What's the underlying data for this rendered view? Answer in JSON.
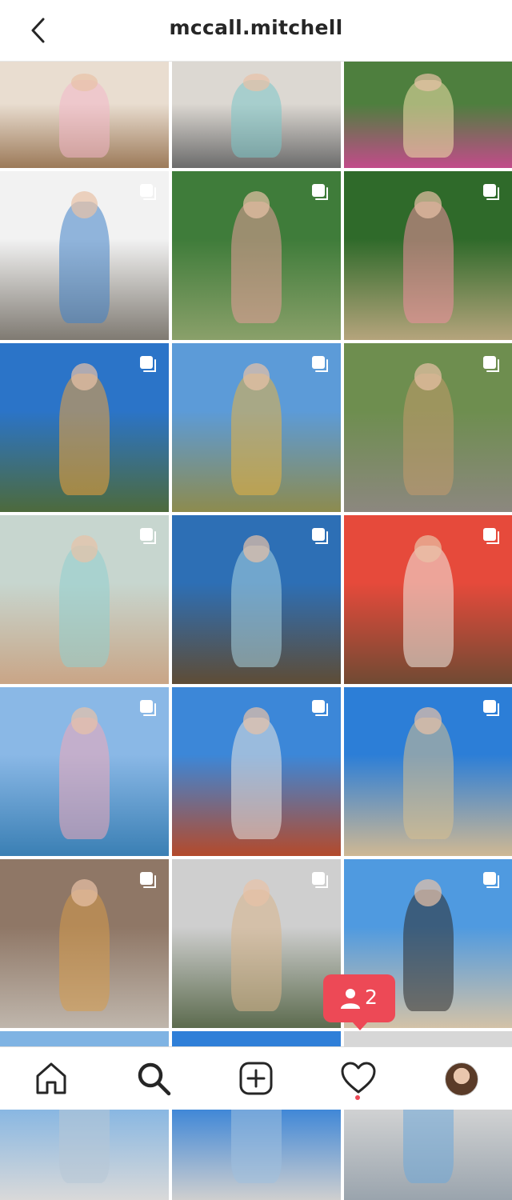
{
  "header": {
    "username": "mccall.mitchell",
    "back_icon": "chevron-left-icon"
  },
  "grid": {
    "posts": [
      {
        "multi": false,
        "top": "#e9ddd0",
        "bottom": "#9c7a59",
        "accent": "#f3b6c9"
      },
      {
        "multi": false,
        "top": "#dcd8d2",
        "bottom": "#6b6b6b",
        "accent": "#7cc7c9"
      },
      {
        "multi": false,
        "top": "#4e7f3e",
        "bottom": "#c24b8a",
        "accent": "#f2e2a9"
      },
      {
        "multi": true,
        "top": "#f2f2f2",
        "bottom": "#7f7a72",
        "accent": "#3f82c9"
      },
      {
        "multi": true,
        "top": "#3f7c3a",
        "bottom": "#8aa06a",
        "accent": "#e79c9a"
      },
      {
        "multi": true,
        "top": "#2f6a2a",
        "bottom": "#b5a47c",
        "accent": "#f08ea0"
      },
      {
        "multi": true,
        "top": "#2b74c8",
        "bottom": "#4d6a3c",
        "accent": "#f0a33a"
      },
      {
        "multi": true,
        "top": "#5c9bd8",
        "bottom": "#8d8b4e",
        "accent": "#e7b243"
      },
      {
        "multi": true,
        "top": "#6e8e4f",
        "bottom": "#8c877f",
        "accent": "#c59a6c"
      },
      {
        "multi": true,
        "top": "#c7d6cf",
        "bottom": "#c9a586",
        "accent": "#8fcfd0"
      },
      {
        "multi": true,
        "top": "#2d6fb5",
        "bottom": "#5e4c36",
        "accent": "#a9d4e0"
      },
      {
        "multi": true,
        "top": "#e64a3b",
        "bottom": "#704a33",
        "accent": "#f2efe7"
      },
      {
        "multi": true,
        "top": "#8ab8e6",
        "bottom": "#3a7fb4",
        "accent": "#f3a7b6"
      },
      {
        "multi": true,
        "top": "#3c87d8",
        "bottom": "#b44a2b",
        "accent": "#e8e6e2"
      },
      {
        "multi": true,
        "top": "#2c7ed7",
        "bottom": "#cfb893",
        "accent": "#d7c08f"
      },
      {
        "multi": true,
        "top": "#8f7766",
        "bottom": "#bfb6ac",
        "accent": "#d59a4a"
      },
      {
        "multi": true,
        "top": "#cfcfcf",
        "bottom": "#5c6b4e",
        "accent": "#d9b48a"
      },
      {
        "multi": true,
        "top": "#4f9ae0",
        "bottom": "#d3c2a7",
        "accent": "#2b2b2b"
      },
      {
        "multi": false,
        "top": "#7fb3e3",
        "bottom": "#d9d9d9",
        "accent": "#b6c7d6"
      },
      {
        "multi": false,
        "top": "#2f7fd8",
        "bottom": "#cfcfcf",
        "accent": "#9fc0df"
      },
      {
        "multi": false,
        "top": "#d7d7d7",
        "bottom": "#9aa4ad",
        "accent": "#6ea8d8"
      }
    ]
  },
  "notification": {
    "count": "2",
    "icon": "person-icon"
  },
  "bottom_nav": {
    "items": [
      "home-icon",
      "search-icon",
      "new-post-icon",
      "activity-heart-icon",
      "profile-avatar"
    ]
  },
  "colors": {
    "accent_red": "#ed4956",
    "text": "#262626"
  }
}
